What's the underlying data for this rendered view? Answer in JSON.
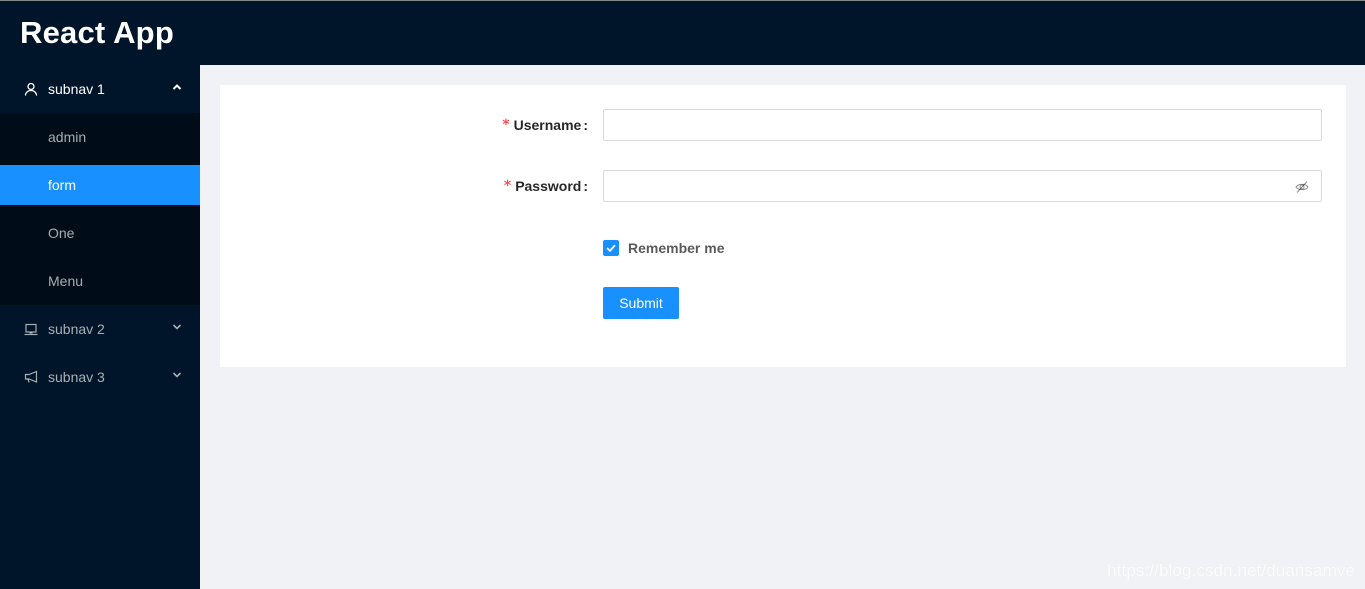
{
  "app": {
    "title": "React App"
  },
  "sidebar": {
    "subnav1": {
      "label": "subnav 1",
      "icon": "user-icon",
      "expanded": true,
      "items": [
        {
          "label": "admin",
          "selected": false
        },
        {
          "label": "form",
          "selected": true
        },
        {
          "label": "One",
          "selected": false
        },
        {
          "label": "Menu",
          "selected": false
        }
      ]
    },
    "subnav2": {
      "label": "subnav 2",
      "icon": "laptop-icon",
      "expanded": false
    },
    "subnav3": {
      "label": "subnav 3",
      "icon": "notification-icon",
      "expanded": false
    }
  },
  "form": {
    "username": {
      "label": "Username",
      "required": true,
      "value": "",
      "placeholder": ""
    },
    "password": {
      "label": "Password",
      "required": true,
      "value": "",
      "placeholder": "",
      "toggle_icon": "eye-invisible-icon"
    },
    "remember": {
      "label": "Remember me",
      "checked": true
    },
    "submit_label": "Submit",
    "required_mark": "*",
    "colon": ":"
  },
  "colors": {
    "primary": "#1890ff",
    "sider": "#001529",
    "submenu": "#000c17",
    "required": "#ff4d4f"
  },
  "watermark": "https://blog.csdn.net/duansamve"
}
